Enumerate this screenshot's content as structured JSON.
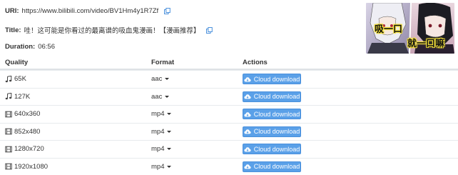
{
  "info": {
    "uri_label": "URI:",
    "uri_value": "https://www.bilibili.com/video/BV1Hm4y1R7Zf",
    "title_label": "Title:",
    "title_value": "哇！这可能是你看过的最离谱的吸血鬼漫画！【漫画推荐】",
    "duration_label": "Duration:",
    "duration_value": "06:56"
  },
  "thumbnail": {
    "text_top": "吸一口",
    "text_bottom": "就一口嘛"
  },
  "table": {
    "headers": [
      "Quality",
      "Format",
      "Actions"
    ],
    "rows": [
      {
        "quality": "65K",
        "kind": "audio",
        "format": "aac",
        "action": "Cloud download"
      },
      {
        "quality": "127K",
        "kind": "audio",
        "format": "aac",
        "action": "Cloud download"
      },
      {
        "quality": "640x360",
        "kind": "video",
        "format": "mp4",
        "action": "Cloud download"
      },
      {
        "quality": "852x480",
        "kind": "video",
        "format": "mp4",
        "action": "Cloud download"
      },
      {
        "quality": "1280x720",
        "kind": "video",
        "format": "mp4",
        "action": "Cloud download"
      },
      {
        "quality": "1920x1080",
        "kind": "video",
        "format": "mp4",
        "action": "Cloud download"
      }
    ]
  },
  "icons": {
    "audio": "music-note-icon",
    "video": "film-icon",
    "copy": "copy-icon",
    "cloud": "cloud-download-icon",
    "caret": "caret-down-icon"
  },
  "colors": {
    "button": "#5aa0e8",
    "copy_icon": "#4a90dc"
  }
}
